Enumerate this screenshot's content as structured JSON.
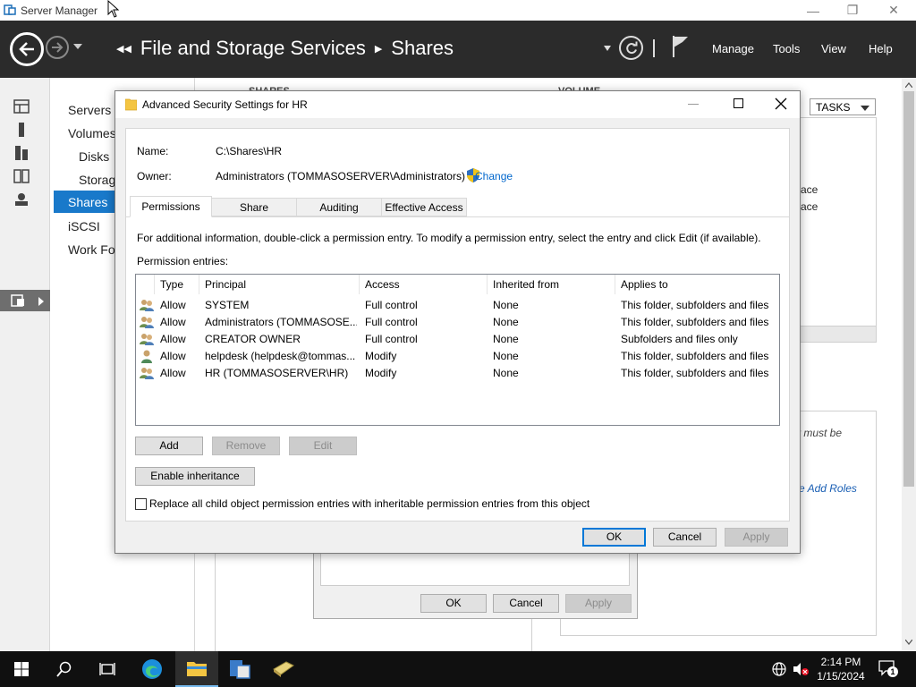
{
  "server_manager": {
    "window_title": "Server Manager",
    "breadcrumb": [
      "File and Storage Services",
      "Shares"
    ],
    "menu": [
      "Manage",
      "Tools",
      "View",
      "Help"
    ],
    "subnav": [
      "Servers",
      "Volumes",
      "Disks",
      "Storag",
      "Shares",
      "iSCSI",
      "Work Fo"
    ],
    "background": {
      "shares_header": "SHARES",
      "volume_header": "VOLUME",
      "tasks_label": "TASKS",
      "partial_text_1": "ace",
      "partial_text_2": "ace",
      "must_be_text": "r must be",
      "add_roles_link": "e Add Roles"
    },
    "bg_dialog": {
      "ok_label": "OK",
      "cancel_label": "Cancel",
      "apply_label": "Apply"
    }
  },
  "dialog": {
    "title": "Advanced Security Settings for HR",
    "name_label": "Name:",
    "name_value": "C:\\Shares\\HR",
    "owner_label": "Owner:",
    "owner_value": "Administrators (TOMMASOSERVER\\Administrators)",
    "change_label": "Change",
    "tabs": [
      "Permissions",
      "Share",
      "Auditing",
      "Effective Access"
    ],
    "active_tab": "Permissions",
    "info_text": "For additional information, double-click a permission entry. To modify a permission entry, select the entry and click Edit (if available).",
    "entries_label": "Permission entries:",
    "columns": [
      "Type",
      "Principal",
      "Access",
      "Inherited from",
      "Applies to"
    ],
    "entries": [
      {
        "type": "Allow",
        "principal": "SYSTEM",
        "access": "Full control",
        "inherited": "None",
        "applies": "This folder, subfolders and files",
        "icon": "group-icon"
      },
      {
        "type": "Allow",
        "principal": "Administrators (TOMMASOSE...",
        "access": "Full control",
        "inherited": "None",
        "applies": "This folder, subfolders and files",
        "icon": "group-icon"
      },
      {
        "type": "Allow",
        "principal": "CREATOR OWNER",
        "access": "Full control",
        "inherited": "None",
        "applies": "Subfolders and files only",
        "icon": "group-icon"
      },
      {
        "type": "Allow",
        "principal": "helpdesk (helpdesk@tommas...",
        "access": "Modify",
        "inherited": "None",
        "applies": "This folder, subfolders and files",
        "icon": "user-icon"
      },
      {
        "type": "Allow",
        "principal": "HR (TOMMASOSERVER\\HR)",
        "access": "Modify",
        "inherited": "None",
        "applies": "This folder, subfolders and files",
        "icon": "group-icon"
      }
    ],
    "add_label": "Add",
    "remove_label": "Remove",
    "edit_label": "Edit",
    "enable_inheritance_label": "Enable inheritance",
    "replace_label": "Replace all child object permission entries with inheritable permission entries from this object",
    "replace_checked": false,
    "ok_label": "OK",
    "cancel_label": "Cancel",
    "apply_label": "Apply"
  },
  "taskbar": {
    "time": "2:14 PM",
    "date": "1/15/2024",
    "notification_count": "1"
  },
  "colors": {
    "header_bg": "#2b2b2b",
    "selection_blue": "#1979ca",
    "link_blue": "#0066cc",
    "taskbar_bg": "#101010"
  }
}
